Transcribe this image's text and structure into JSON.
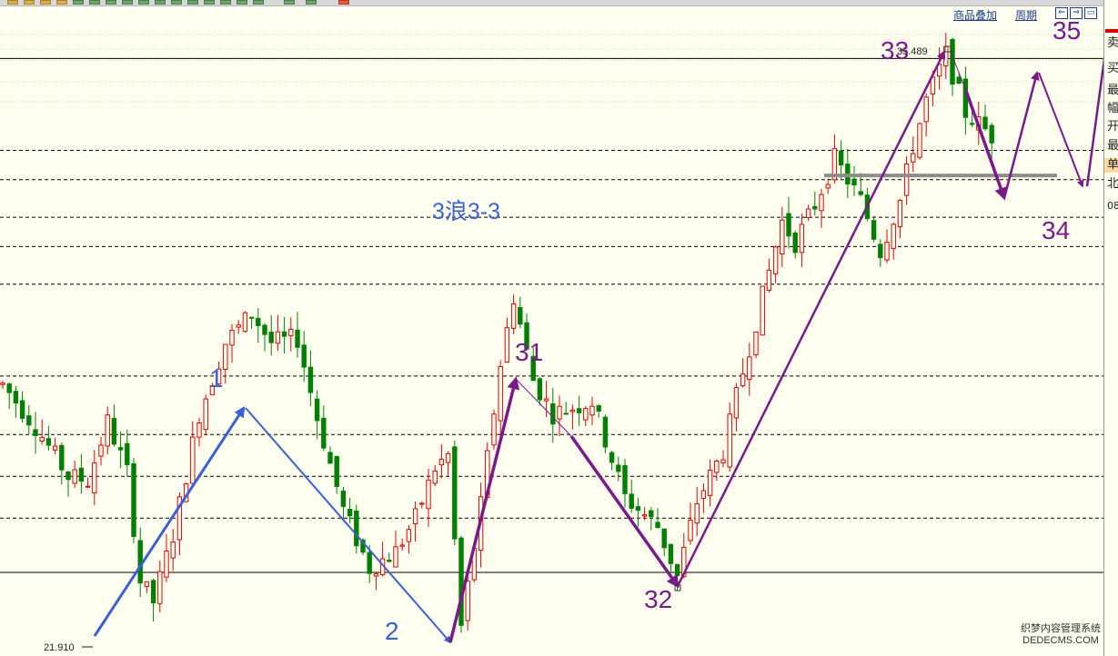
{
  "toolbar": {
    "links": [
      "商品叠加",
      "周期"
    ],
    "nav_icons": [
      "scroll-left-icon",
      "scroll-right-icon",
      "window-icon"
    ]
  },
  "right_panel": {
    "labels": [
      "卖",
      "买",
      "最",
      "幅",
      "开",
      "最",
      "单",
      "北",
      "08"
    ],
    "highlight_color": "#ffd9a0",
    "accent_color": "#e00000"
  },
  "watermark": {
    "line1": "织梦内容管理系统",
    "line2": "DEDECMS.COM"
  },
  "colors": {
    "background": "#ffffef",
    "up_candle": "#e00000",
    "down_candle": "#008000",
    "impulse_arrow": "#3a5fd8",
    "wave_arrow": "#7a1a8a",
    "support_line": "#8c8c8c",
    "grid_line": "#000000"
  },
  "chart_data": {
    "type": "candlestick",
    "title": "3浪3-3",
    "price_labels": {
      "low": "21.910",
      "high": "35.489"
    },
    "y_range": [
      21.2,
      36.9
    ],
    "candles_visible": 152,
    "wave_labels": [
      {
        "label": "1",
        "group": "impulse",
        "price": 29.5
      },
      {
        "label": "2",
        "group": "impulse",
        "price": 21.7
      },
      {
        "label": "31",
        "group": "wave",
        "price": 29.8
      },
      {
        "label": "32",
        "group": "wave",
        "price": 23.1
      },
      {
        "label": "33",
        "group": "wave",
        "price": 35.5
      },
      {
        "label": "34",
        "group": "wave",
        "price": 32.6
      },
      {
        "label": "35",
        "group": "wave",
        "price": 37.0
      }
    ],
    "support_level": 32.7,
    "dashed_levels": [
      33.3,
      32.6,
      31.7,
      31.0,
      30.1,
      27.9,
      26.5,
      25.5,
      24.5
    ],
    "solid_levels": [
      35.5,
      23.2
    ]
  }
}
